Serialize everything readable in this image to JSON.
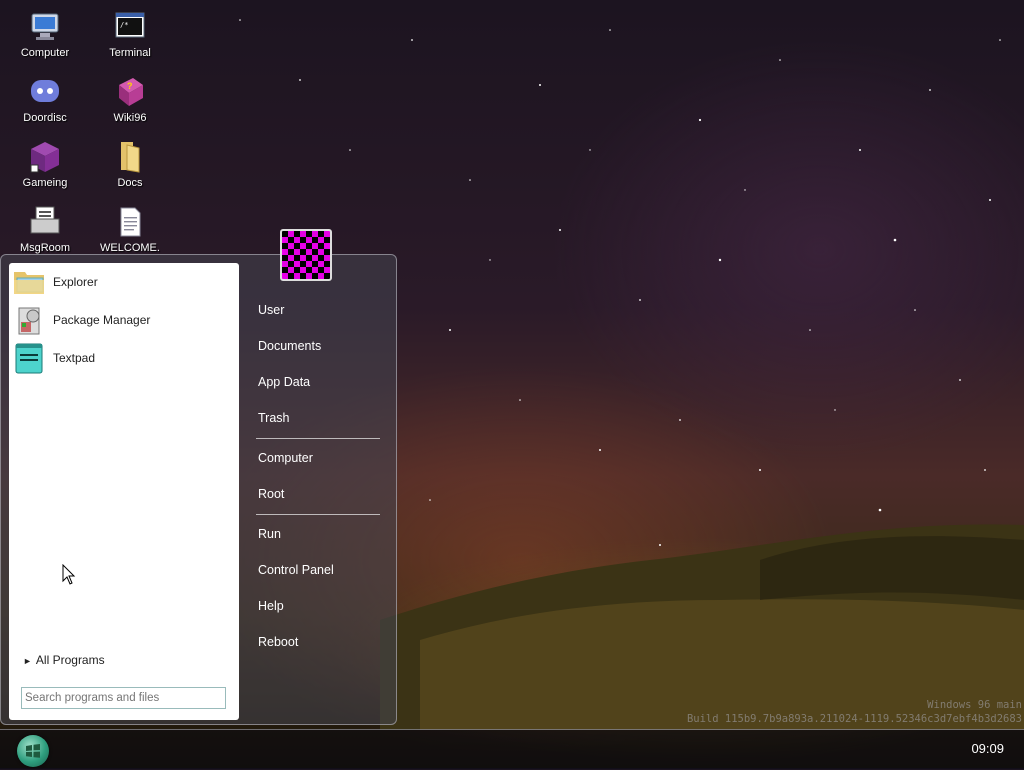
{
  "desktop": {
    "icons": [
      {
        "label": "Computer",
        "icon": "computer-icon"
      },
      {
        "label": "Terminal",
        "icon": "terminal-icon"
      },
      {
        "label": "Doordisc",
        "icon": "doordisc-icon"
      },
      {
        "label": "Wiki96",
        "icon": "wiki-book-icon"
      },
      {
        "label": "Gameing",
        "icon": "game-cube-icon"
      },
      {
        "label": "Docs",
        "icon": "folder-icon"
      },
      {
        "label": "MsgRoom",
        "icon": "msgroom-icon"
      },
      {
        "label": "WELCOME.",
        "icon": "text-file-icon"
      }
    ]
  },
  "start_menu": {
    "programs": [
      {
        "label": "Explorer",
        "icon": "explorer-folder-icon"
      },
      {
        "label": "Package Manager",
        "icon": "package-manager-icon"
      },
      {
        "label": "Textpad",
        "icon": "textpad-icon"
      }
    ],
    "all_programs": "All Programs",
    "search_placeholder": "Search programs and files",
    "right_items": [
      "User",
      "Documents",
      "App Data",
      "Trash",
      "Computer",
      "Root",
      "Run",
      "Control Panel",
      "Help",
      "Reboot"
    ]
  },
  "taskbar": {
    "clock": "09:09",
    "start_icon": "windows-start-icon"
  },
  "watermark": {
    "line1": "Windows 96 main",
    "line2": "Build 115b9.7b9a893a.211024-1119.52346c3d7ebf4b3d2683"
  }
}
